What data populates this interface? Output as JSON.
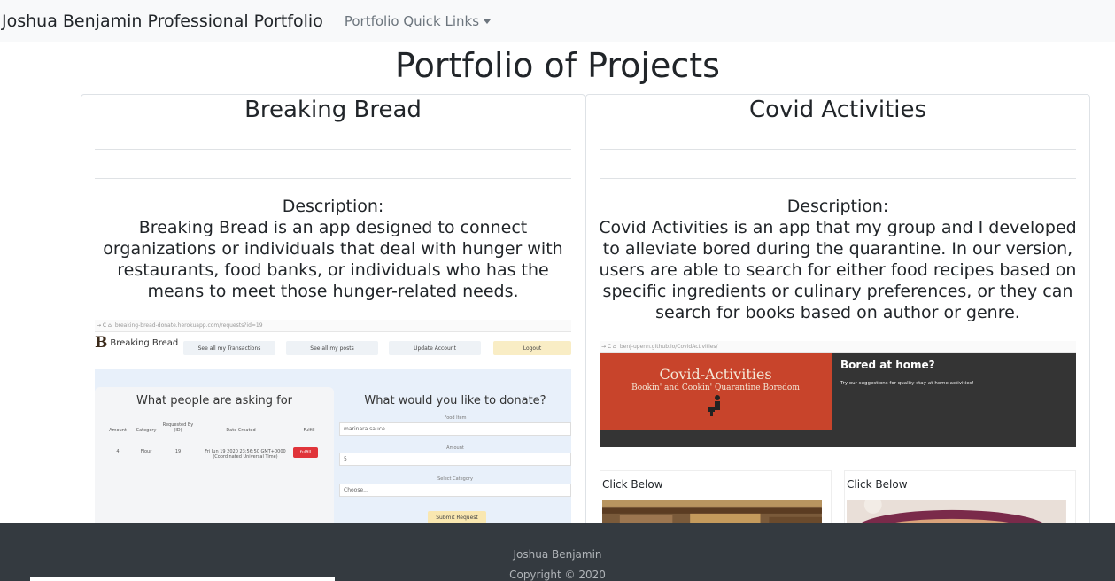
{
  "navbar": {
    "brand": "Joshua Benjamin Professional Portfolio",
    "dropdown_label": "Portfolio Quick Links"
  },
  "page_title": "Portfolio of Projects",
  "projects": [
    {
      "title": "Breaking Bread",
      "description_heading": "Description:",
      "description": "Breaking Bread is an app designed to connect organizations or individuals that deal with hunger with restaurants, food banks, or individuals who has the means to meet those hunger-related needs.",
      "screenshot": {
        "url": "breaking-bread-donate.herokuapp.com/requests?id=19",
        "logo": "Breaking Bread",
        "nav_buttons": [
          "See all my Transactions",
          "See all my posts",
          "Update Account",
          "Logout"
        ],
        "left_heading": "What people are asking for",
        "table_headers": [
          "Amount",
          "Category",
          "Requested By (ID)",
          "Date Created",
          "Fulfill"
        ],
        "table_row": [
          "4",
          "Flour",
          "19",
          "Fri Jun 19 2020 23:56:50 GMT+0000 (Coordinated Universal Time)"
        ],
        "fulfill_label": "fulfill",
        "right_heading": "What would you like to donate?",
        "field_food": "Food Item",
        "field_food_value": "marinara sauce",
        "field_amount": "Amount",
        "field_amount_value": "5",
        "field_category": "Select Category",
        "field_category_value": "Choose...",
        "submit": "Submit Request"
      }
    },
    {
      "title": "Covid Activities",
      "description_heading": "Description:",
      "description": "Covid Activities is an app that my group and I developed to alleviate bored during the quarantine. In our version, users are able to search for either food recipes based on specific ingredients or culinary preferences, or they can search for books based on author or genre.",
      "screenshot": {
        "url": "benj-upenn.github.io/CovidActivities/",
        "banner_title": "Covid-Activities",
        "banner_subtitle": "Bookin' and Cookin' Quarantine Boredom",
        "bored": "Bored at home?",
        "suggestion": "Try our suggestions for quality stay-at-home activities!",
        "cards": [
          "Click Below",
          "Click Below"
        ]
      }
    }
  ],
  "footer": {
    "name": "Joshua Benjamin",
    "copyright": "Copyright © 2020"
  }
}
